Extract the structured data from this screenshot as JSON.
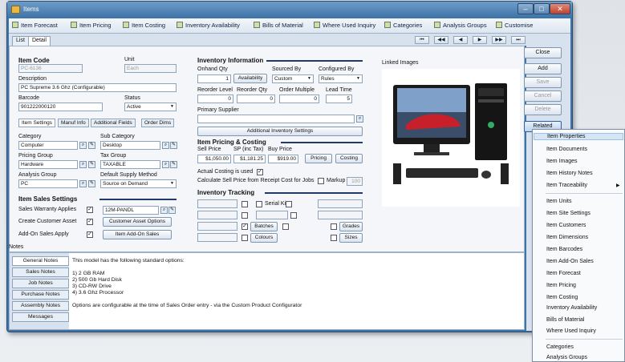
{
  "window": {
    "title": "Items"
  },
  "toolbar": {
    "items": [
      "Item Forecast",
      "Item Pricing",
      "Item Costing",
      "Inventory Availability",
      "Bills of Material",
      "Where Used Inquiry",
      "Categories",
      "Analysis Groups",
      "Customise"
    ]
  },
  "view_tabs": [
    "List",
    "Detail"
  ],
  "nav": [
    "⏮",
    "◀◀",
    "◀",
    "▶",
    "▶▶",
    "⏭"
  ],
  "item": {
    "code_label": "Item Code",
    "code": "PC-6136",
    "unit_label": "Unit",
    "unit": "Each",
    "description_label": "Description",
    "description": "PC Supreme 3.6 Ghz (Configurable)",
    "barcode_label": "Barcode",
    "barcode": "901222000120",
    "status_label": "Status",
    "status": "Active"
  },
  "settings_tabs": [
    "Item Settings",
    "Manuf Info",
    "Additional Fields",
    "Order Dims"
  ],
  "settings": {
    "category_label": "Category",
    "category": "Computer",
    "subcategory_label": "Sub Category",
    "subcategory": "Desktop",
    "pricing_group_label": "Pricing Group",
    "pricing_group": "Hardware",
    "tax_group_label": "Tax Group",
    "tax_group": "TAXABLE",
    "analysis_group_label": "Analysis Group",
    "analysis_group": "PC",
    "default_supply_label": "Default Supply Method",
    "default_supply": "Source on Demand"
  },
  "sales": {
    "heading": "Item Sales Settings",
    "warranty_label": "Sales Warranty Applies",
    "warranty_value": "12M-PANDL",
    "customer_asset_label": "Create Customer Asset",
    "customer_asset_button": "Customer Asset Options",
    "addon_label": "Add-On Sales Apply",
    "addon_button": "Item Add-On Sales"
  },
  "inventory": {
    "heading": "Inventory Information",
    "onhand_label": "Onhand Qty",
    "onhand": "1",
    "availability_button": "Availability",
    "sourced_label": "Sourced By",
    "sourced": "Custom",
    "configured_label": "Configured By",
    "configured": "Rules",
    "reorder_level_label": "Reorder Level",
    "reorder_level": "0",
    "reorder_qty_label": "Reorder Qty",
    "reorder_qty": "0",
    "order_multiple_label": "Order Multiple",
    "order_multiple": "0",
    "lead_time_label": "Lead Time",
    "lead_time": "5",
    "supplier_label": "Primary Supplier",
    "supplier": "",
    "additional_button": "Additional Inventory Settings"
  },
  "pricing": {
    "heading": "Item Pricing & Costing",
    "sell_label": "Sell Price",
    "sell": "$1,050.00",
    "sp_label": "SP (inc Tax)",
    "sp": "$1,181.25",
    "buy_label": "Buy Price",
    "buy": "$919.00",
    "pricing_button": "Pricing",
    "costing_button": "Costing",
    "actual_costing_label": "Actual Costing is used",
    "calc_label": "Calculate Sell Price from Receipt Cost for Jobs",
    "markup_label": "Markup",
    "markup": "100"
  },
  "tracking": {
    "heading": "Inventory Tracking",
    "serial_label": "Serial Kit",
    "batches_button": "Batches",
    "colours_button": "Colours",
    "grades_button": "Grades",
    "sizes_button": "Sizes"
  },
  "images": {
    "heading": "Linked Images"
  },
  "notes": {
    "heading": "Notes",
    "tabs": [
      "General Notes",
      "Sales Notes",
      "Job Notes",
      "Purchase Notes",
      "Assembly Notes",
      "Messages"
    ],
    "lines": [
      "This model has the following standard options:",
      "1) 2 GB RAM",
      "2) 500 Gb Hard Disk",
      "3) CD-RW Drive",
      "4) 3.6 Ghz Processor",
      "Options are configurable at the time of Sales Order entry - via the Custom Product Configurator"
    ]
  },
  "actions": [
    "Close",
    "Add",
    "Save",
    "Cancel",
    "Delete",
    "Related"
  ],
  "menu": {
    "items": [
      "Item Properties",
      "Item Documents",
      "Item Images",
      "Item History Notes",
      "Item Traceability",
      "Item Units",
      "Item Site Settings",
      "Item Customers",
      "Item Dimensions",
      "Item Barcodes",
      "Item Add-On Sales",
      "Item Forecast",
      "Item Pricing",
      "Item Costing",
      "Inventory Availability",
      "Bills of Material",
      "Where Used Inquiry",
      "Categories",
      "Analysis Groups"
    ]
  }
}
